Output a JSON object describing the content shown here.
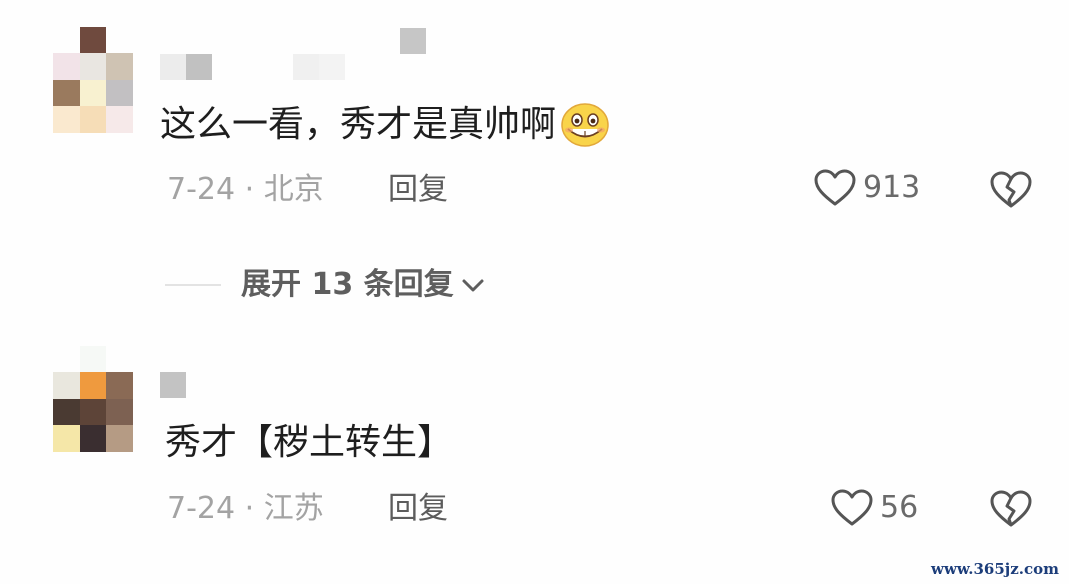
{
  "comments": [
    {
      "text": "这么一看，秀才是真帅啊",
      "emoji": "grinning-emoji",
      "date_location": "7-24 · 北京",
      "reply_label": "回复",
      "likes": "913",
      "expand_label": "展开 13 条回复"
    },
    {
      "text": "秀才【秽土转生】",
      "date_location": "7-24 · 江苏",
      "reply_label": "回复",
      "likes": "56"
    }
  ],
  "icons": {
    "like": "heart-outline-icon",
    "dislike": "broken-heart-icon",
    "expand": "chevron-down-icon"
  },
  "colors": {
    "meta_text": "#a3a3a3",
    "reply_text": "#5c5c5c",
    "icon_stroke": "#555555"
  },
  "watermark": "www.365jz.com"
}
